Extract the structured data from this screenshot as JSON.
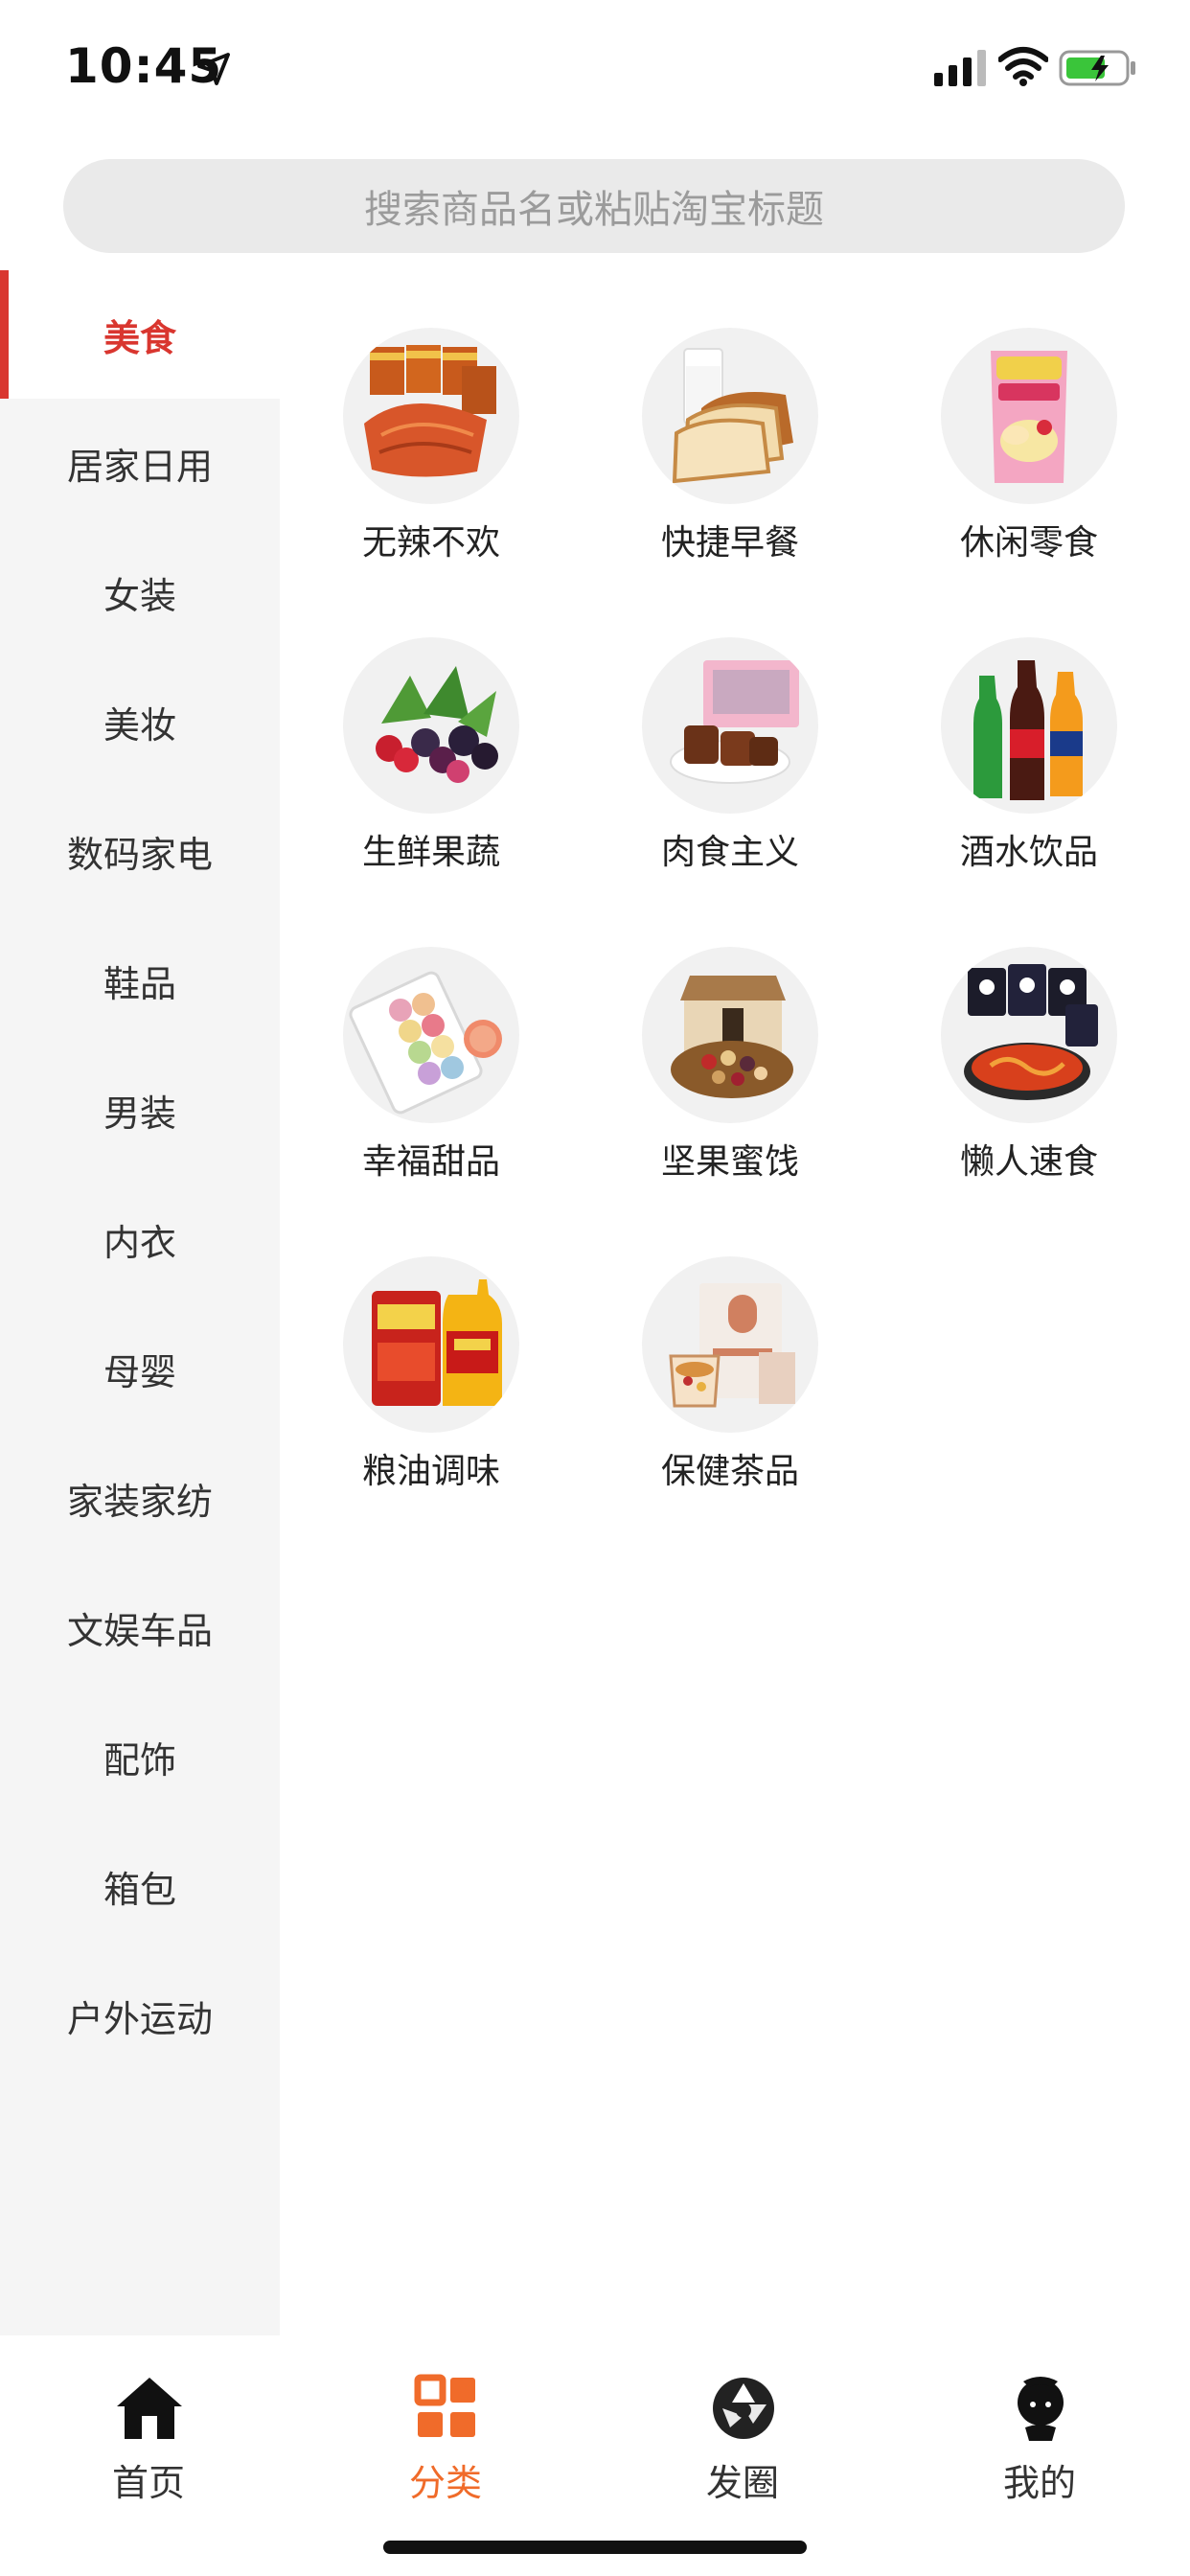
{
  "status_bar": {
    "time": "10:45"
  },
  "search": {
    "placeholder": "搜索商品名或粘贴淘宝标题"
  },
  "sidebar": {
    "items": [
      {
        "label": "美食",
        "active": true
      },
      {
        "label": "居家日用"
      },
      {
        "label": "女装"
      },
      {
        "label": "美妆"
      },
      {
        "label": "数码家电"
      },
      {
        "label": "鞋品"
      },
      {
        "label": "男装"
      },
      {
        "label": "内衣"
      },
      {
        "label": "母婴"
      },
      {
        "label": "家装家纺"
      },
      {
        "label": "文娱车品"
      },
      {
        "label": "配饰"
      },
      {
        "label": "箱包"
      },
      {
        "label": "户外运动"
      }
    ]
  },
  "categories": [
    {
      "label": "无辣不欢",
      "image": "spicy-snack-image"
    },
    {
      "label": "快捷早餐",
      "image": "bread-milk-image"
    },
    {
      "label": "休闲零食",
      "image": "chips-bag-image"
    },
    {
      "label": "生鲜果蔬",
      "image": "berries-image"
    },
    {
      "label": "肉食主义",
      "image": "meat-box-image"
    },
    {
      "label": "酒水饮品",
      "image": "soda-bottles-image"
    },
    {
      "label": "幸福甜品",
      "image": "macarons-image"
    },
    {
      "label": "坚果蜜饯",
      "image": "nuts-box-image"
    },
    {
      "label": "懒人速食",
      "image": "instant-noodles-image"
    },
    {
      "label": "粮油调味",
      "image": "rice-oil-image"
    },
    {
      "label": "保健茶品",
      "image": "tea-box-image"
    }
  ],
  "tab_bar": {
    "tabs": [
      {
        "label": "首页",
        "icon": "home-icon"
      },
      {
        "label": "分类",
        "icon": "category-icon",
        "active": true
      },
      {
        "label": "发圈",
        "icon": "aperture-icon"
      },
      {
        "label": "我的",
        "icon": "profile-icon"
      }
    ]
  },
  "colors": {
    "accent_red": "#d9362f",
    "tab_active": "#f06b2a"
  }
}
